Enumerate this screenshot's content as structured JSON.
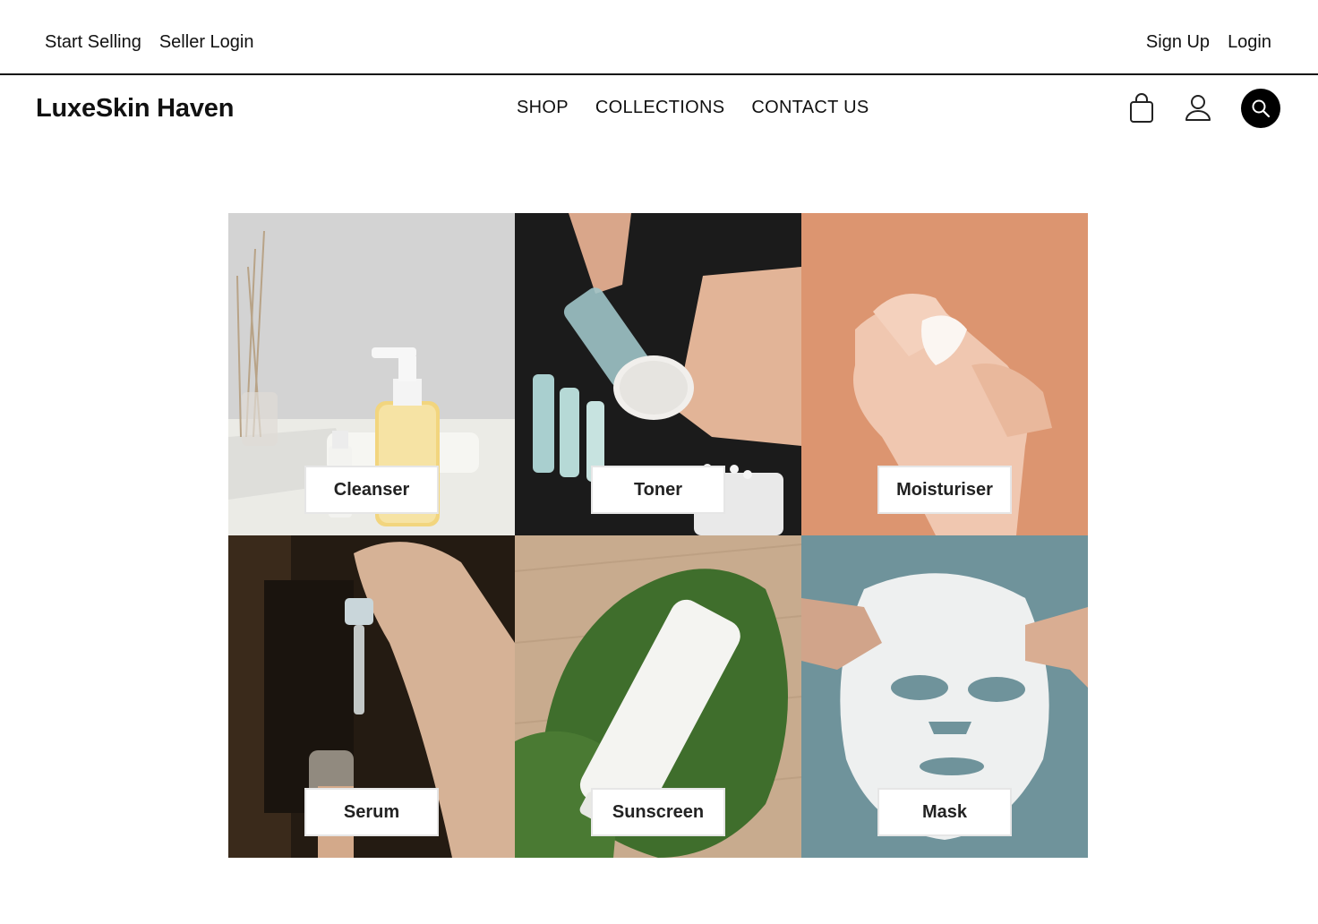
{
  "topbar": {
    "start_selling": "Start Selling",
    "seller_login": "Seller Login",
    "sign_up": "Sign Up",
    "login": "Login"
  },
  "header": {
    "logo": "LuxeSkin Haven",
    "nav": [
      "SHOP",
      "COLLECTIONS",
      "CONTACT US"
    ],
    "icons": [
      "shopping-bag-icon",
      "user-icon",
      "search-icon"
    ]
  },
  "categories": [
    {
      "label": "Cleanser",
      "bg": "#cfcfcf"
    },
    {
      "label": "Toner",
      "bg": "#1e1e1e"
    },
    {
      "label": "Moisturiser",
      "bg": "#d98f69"
    },
    {
      "label": "Serum",
      "bg": "#2a2016"
    },
    {
      "label": "Sunscreen",
      "bg": "#c9ad90"
    },
    {
      "label": "Mask",
      "bg": "#6f939b"
    }
  ]
}
